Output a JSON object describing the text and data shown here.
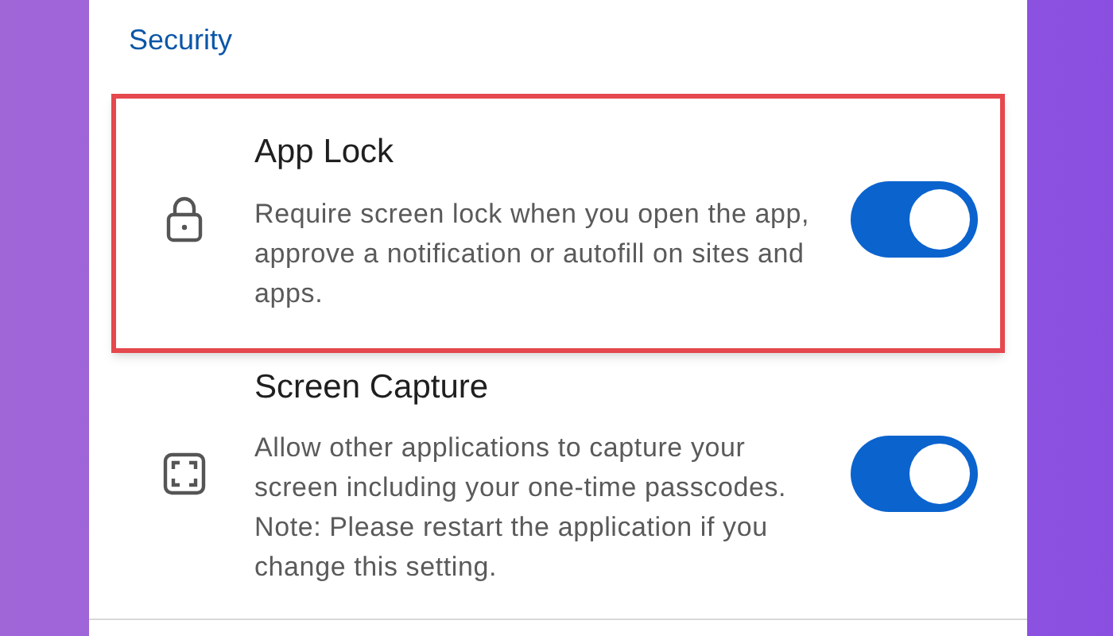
{
  "section": {
    "title": "Security"
  },
  "settings": [
    {
      "kind": "lock",
      "title": "App Lock",
      "description": "Require screen lock when you open the app, approve a notification or autofill on sites and apps.",
      "on": true,
      "highlighted": true
    },
    {
      "kind": "capture",
      "title": "Screen Capture",
      "description": "Allow other applications to capture your screen including your one-time passcodes. Note: Please restart the application if you change this setting.",
      "on": true,
      "highlighted": false
    }
  ]
}
